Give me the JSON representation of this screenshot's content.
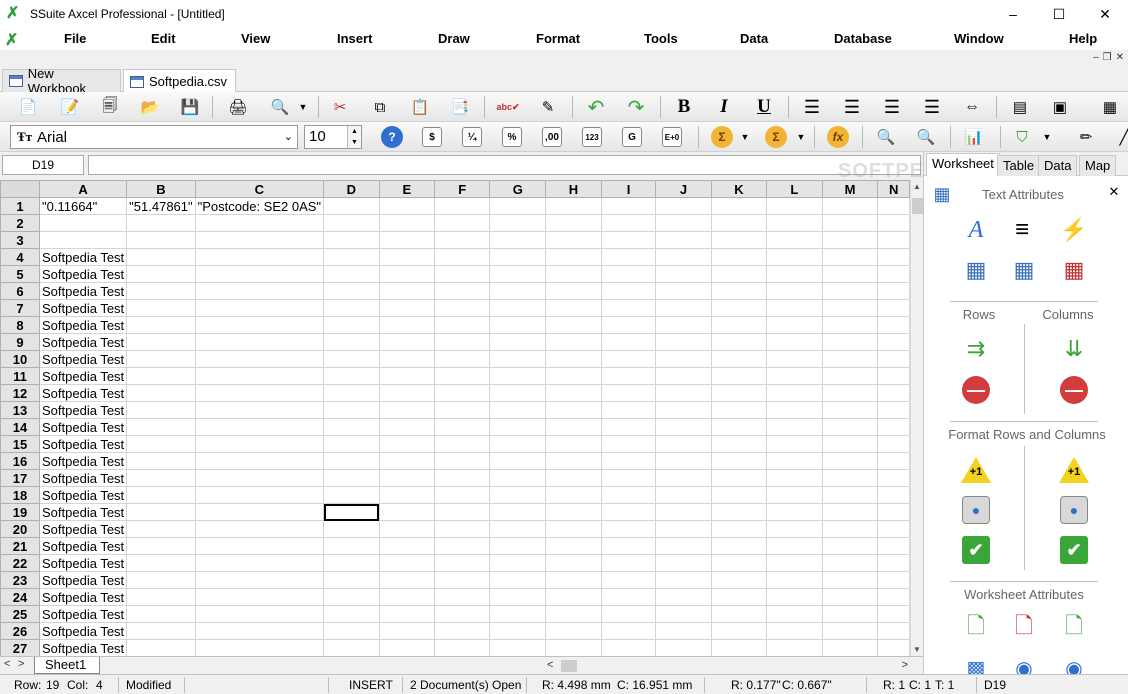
{
  "window": {
    "title": "SSuite Axcel Professional - [Untitled]",
    "minimize": "–",
    "maximize": "☐",
    "close": "✕"
  },
  "menu": [
    "File",
    "Edit",
    "View",
    "Insert",
    "Draw",
    "Format",
    "Tools",
    "Data",
    "Database",
    "Window",
    "Help"
  ],
  "doc_tabs": [
    {
      "label": "New Workbook"
    },
    {
      "label": "Softpedia.csv"
    }
  ],
  "font": {
    "name": "Arial",
    "size": "10"
  },
  "formula_bar": {
    "cell_ref": "D19",
    "content": ""
  },
  "columns": [
    "A",
    "B",
    "C",
    "D",
    "E",
    "F",
    "G",
    "H",
    "I",
    "J",
    "K",
    "L",
    "M",
    "N"
  ],
  "rows": [
    {
      "n": "1",
      "a": "\"0.11664\"",
      "b": "\"51.47861\"",
      "c": "\"Postcode: SE2 0AS\""
    },
    {
      "n": "2",
      "a": ""
    },
    {
      "n": "3",
      "a": ""
    },
    {
      "n": "4",
      "a": "Softpedia Test"
    },
    {
      "n": "5",
      "a": "Softpedia Test"
    },
    {
      "n": "6",
      "a": "Softpedia Test"
    },
    {
      "n": "7",
      "a": "Softpedia Test"
    },
    {
      "n": "8",
      "a": "Softpedia Test"
    },
    {
      "n": "9",
      "a": "Softpedia Test"
    },
    {
      "n": "10",
      "a": "Softpedia Test"
    },
    {
      "n": "11",
      "a": "Softpedia Test"
    },
    {
      "n": "12",
      "a": "Softpedia Test"
    },
    {
      "n": "13",
      "a": "Softpedia Test"
    },
    {
      "n": "14",
      "a": "Softpedia Test"
    },
    {
      "n": "15",
      "a": "Softpedia Test"
    },
    {
      "n": "16",
      "a": "Softpedia Test"
    },
    {
      "n": "17",
      "a": "Softpedia Test"
    },
    {
      "n": "18",
      "a": "Softpedia Test"
    },
    {
      "n": "19",
      "a": "Softpedia Test"
    },
    {
      "n": "20",
      "a": "Softpedia Test"
    },
    {
      "n": "21",
      "a": "Softpedia Test"
    },
    {
      "n": "22",
      "a": "Softpedia Test"
    },
    {
      "n": "23",
      "a": "Softpedia Test"
    },
    {
      "n": "24",
      "a": "Softpedia Test"
    },
    {
      "n": "25",
      "a": "Softpedia Test"
    },
    {
      "n": "26",
      "a": "Softpedia Test"
    },
    {
      "n": "27",
      "a": "Softpedia Test"
    }
  ],
  "selected_cell": "D19",
  "sheet_tabs": [
    "Sheet1"
  ],
  "panel": {
    "tabs": [
      "Worksheet",
      "Table",
      "Data",
      "Map"
    ],
    "close": "✕",
    "sections": {
      "text_attributes": "Text Attributes",
      "rows": "Rows",
      "columns": "Columns",
      "format_rows_columns": "Format Rows and Columns",
      "worksheet_attributes": "Worksheet Attributes"
    }
  },
  "status": {
    "row_label": "Row:",
    "row": "19",
    "col_label": "Col:",
    "col": "4",
    "modified": "Modified",
    "mode": "INSERT",
    "docs_open": "2 Document(s) Open",
    "r_mm": "R: 4.498 mm",
    "c_mm": "C: 16.951 mm",
    "r_in": "R: 0.177\"",
    "c_in": "C: 0.667\"",
    "r1": "R: 1",
    "c1": "C: 1",
    "t1": "T: 1",
    "cell": "D19"
  },
  "watermark": "SOFTPEDIA",
  "colors": {
    "accent_green": "#2e9e3a",
    "selection": "#000000",
    "header_bg": "#e4e4e4"
  }
}
